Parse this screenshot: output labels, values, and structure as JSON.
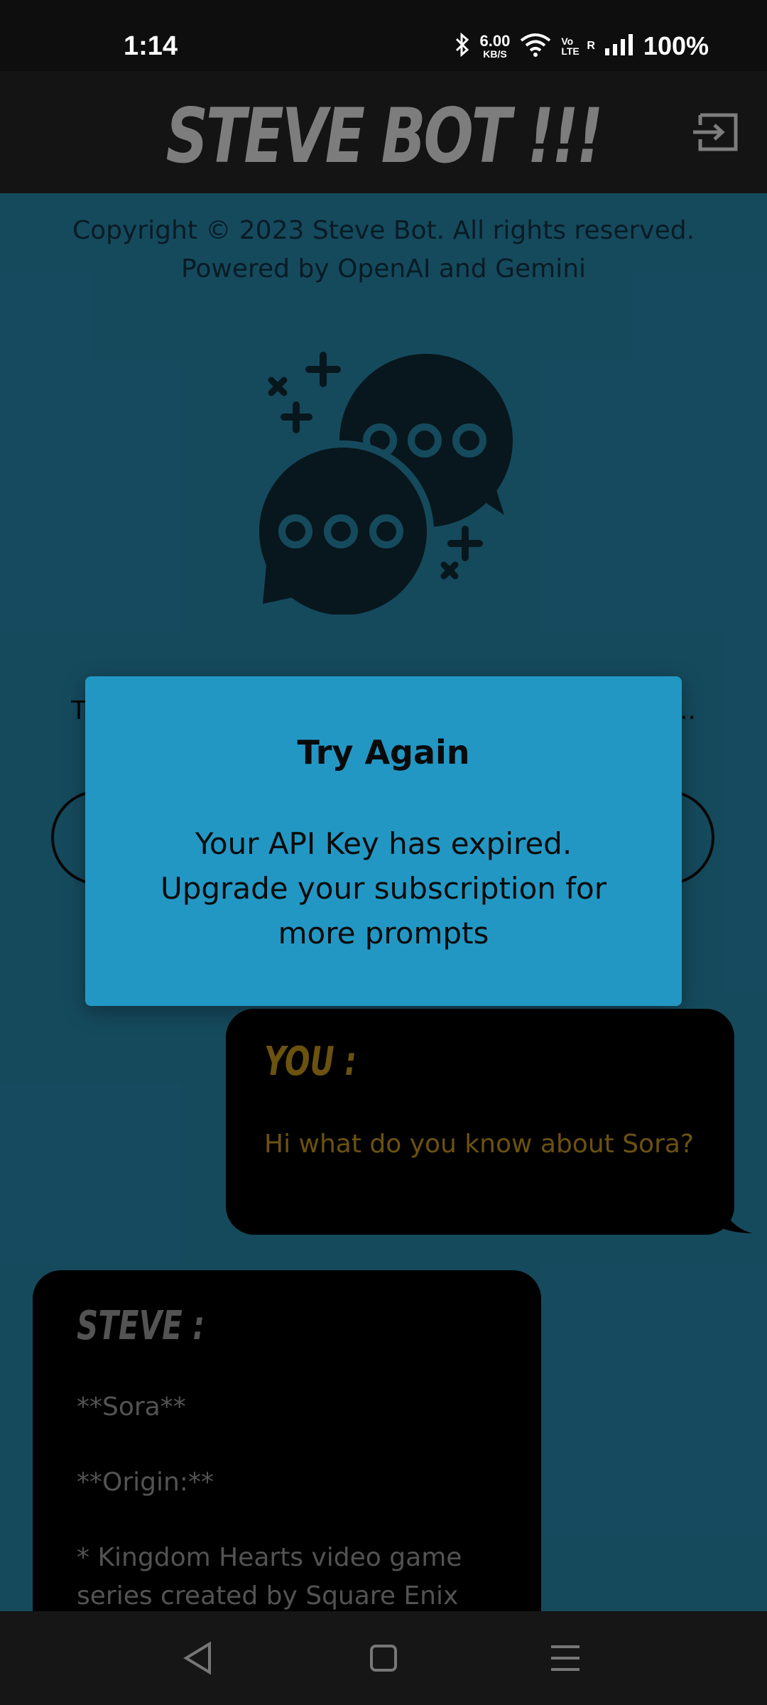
{
  "status_bar": {
    "time": "1:14",
    "net_speed_value": "6.00",
    "net_speed_unit": "KB/S",
    "network_label": "Vo LTE",
    "roaming": "R",
    "battery": "100%"
  },
  "header": {
    "title": "STEVE BOT !!!",
    "logout_icon": "logout-icon"
  },
  "footer": {
    "copyright": "Copyright © 2023 Steve Bot. All rights reserved.",
    "powered_by": "Powered by OpenAI and Gemini"
  },
  "background": {
    "partial_text_left": "T",
    "partial_text_right": "..."
  },
  "modal": {
    "title": "Try Again",
    "message": "Your API Key has expired. Upgrade your subscription for more prompts"
  },
  "chat": {
    "user": {
      "label": "YOU :",
      "message": "Hi what do you know about Sora?"
    },
    "bot": {
      "label": "STEVE :",
      "lines": [
        "**Sora**",
        "**Origin:**",
        "* Kingdom Hearts video game series created by Square Enix"
      ]
    }
  },
  "colors": {
    "background": "#1c5f78",
    "modal": "#2397c3",
    "user_text": "#8a6a14",
    "bot_text": "#6b6b6b"
  }
}
